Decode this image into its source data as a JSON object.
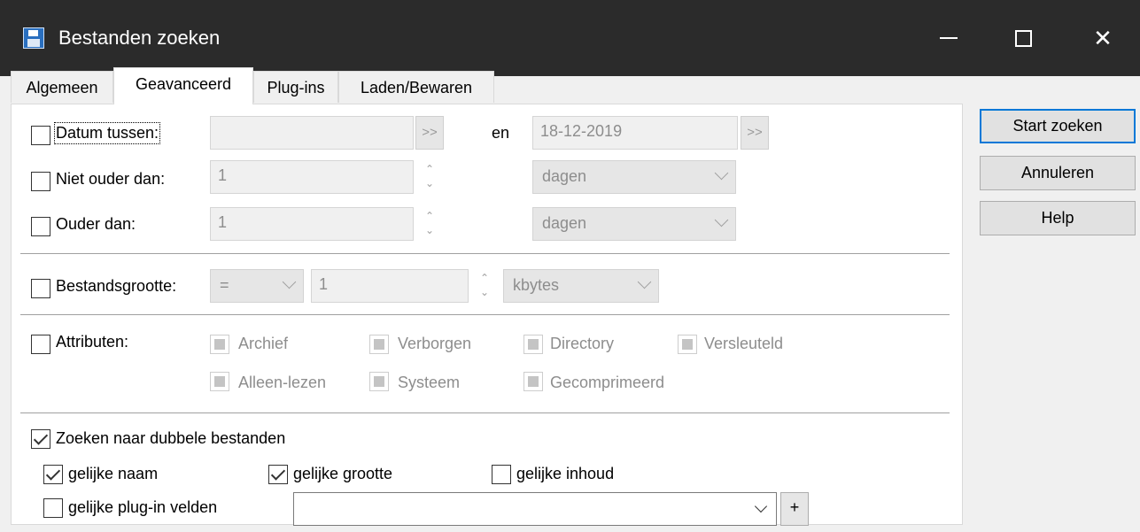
{
  "window": {
    "title": "Bestanden zoeken",
    "minimize_glyph": "—",
    "maximize_glyph": "☐",
    "close_glyph": "✕"
  },
  "tabs": [
    {
      "label": "Algemeen"
    },
    {
      "label": "Geavanceerd",
      "active": true
    },
    {
      "label": "Plug-ins"
    },
    {
      "label": "Laden/Bewaren"
    }
  ],
  "date_between": {
    "checked": false,
    "label": "Datum tussen:",
    "from_value": "",
    "from_button": ">>",
    "and_label": "en",
    "to_value": "18-12-2019",
    "to_button": ">>"
  },
  "not_older_than": {
    "checked": false,
    "label": "Niet ouder dan:",
    "value": "1",
    "unit": "dagen"
  },
  "older_than": {
    "checked": false,
    "label": "Ouder dan:",
    "value": "1",
    "unit": "dagen"
  },
  "file_size": {
    "checked": false,
    "label": "Bestandsgrootte:",
    "operator": "=",
    "value": "1",
    "unit": "kbytes"
  },
  "attributes": {
    "checked": false,
    "label": "Attributen:",
    "items": [
      {
        "label": "Archief"
      },
      {
        "label": "Verborgen"
      },
      {
        "label": "Directory"
      },
      {
        "label": "Versleuteld"
      },
      {
        "label": "Alleen-lezen"
      },
      {
        "label": "Systeem"
      },
      {
        "label": "Gecomprimeerd"
      }
    ]
  },
  "duplicates": {
    "checked": true,
    "label": "Zoeken naar dubbele bestanden",
    "same_name": {
      "checked": true,
      "label": "gelijke naam"
    },
    "same_size": {
      "checked": true,
      "label": "gelijke grootte"
    },
    "same_content": {
      "checked": false,
      "label": "gelijke inhoud"
    },
    "same_plugin_fields": {
      "checked": false,
      "label": "gelijke plug-in velden"
    },
    "plugin_field_value": "",
    "add_button": "+"
  },
  "buttons": {
    "start": "Start zoeken",
    "cancel": "Annuleren",
    "help": "Help"
  }
}
